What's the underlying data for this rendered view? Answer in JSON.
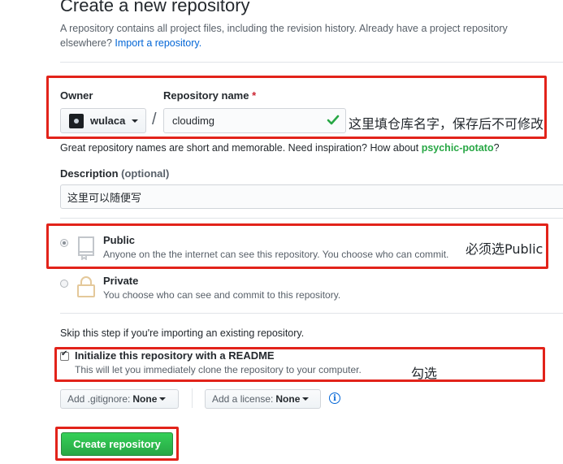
{
  "header": {
    "title": "Create a new repository",
    "intro_text": "A repository contains all project files, including the revision history. Already have a project repository elsewhere?",
    "import_link": "Import a repository."
  },
  "owner": {
    "label": "Owner",
    "value": "wulaca"
  },
  "repo_name": {
    "label": "Repository name",
    "required_mark": "*",
    "separator": "/",
    "value": "cloudimg",
    "annotation": "这里填仓库名字，保存后不可修改"
  },
  "suggestion": {
    "text": "Great repository names are short and memorable. Need inspiration? How about",
    "name": "psychic-potato",
    "suffix": "?"
  },
  "description": {
    "label": "Description",
    "optional": "(optional)",
    "value": "这里可以随便写"
  },
  "visibility": {
    "public": {
      "title": "Public",
      "desc": "Anyone on the the internet can see this repository. You choose who can commit.",
      "selected": true,
      "annotation": "必须选Public"
    },
    "private": {
      "title": "Private",
      "desc": "You choose who can see and commit to this repository.",
      "selected": false
    }
  },
  "init": {
    "skip_text": "Skip this step if you're importing an existing repository.",
    "readme_title": "Initialize this repository with a README",
    "readme_desc": "This will let you immediately clone the repository to your computer.",
    "checked": true,
    "annotation": "勾选"
  },
  "gitignore": {
    "label": "Add .gitignore:",
    "value": "None"
  },
  "license": {
    "label": "Add a license:",
    "value": "None"
  },
  "info_icon": "i",
  "create_button": "Create repository",
  "colors": {
    "highlight_box": "#e2231a",
    "primary_button": "#28a745",
    "link": "#0366d6"
  }
}
